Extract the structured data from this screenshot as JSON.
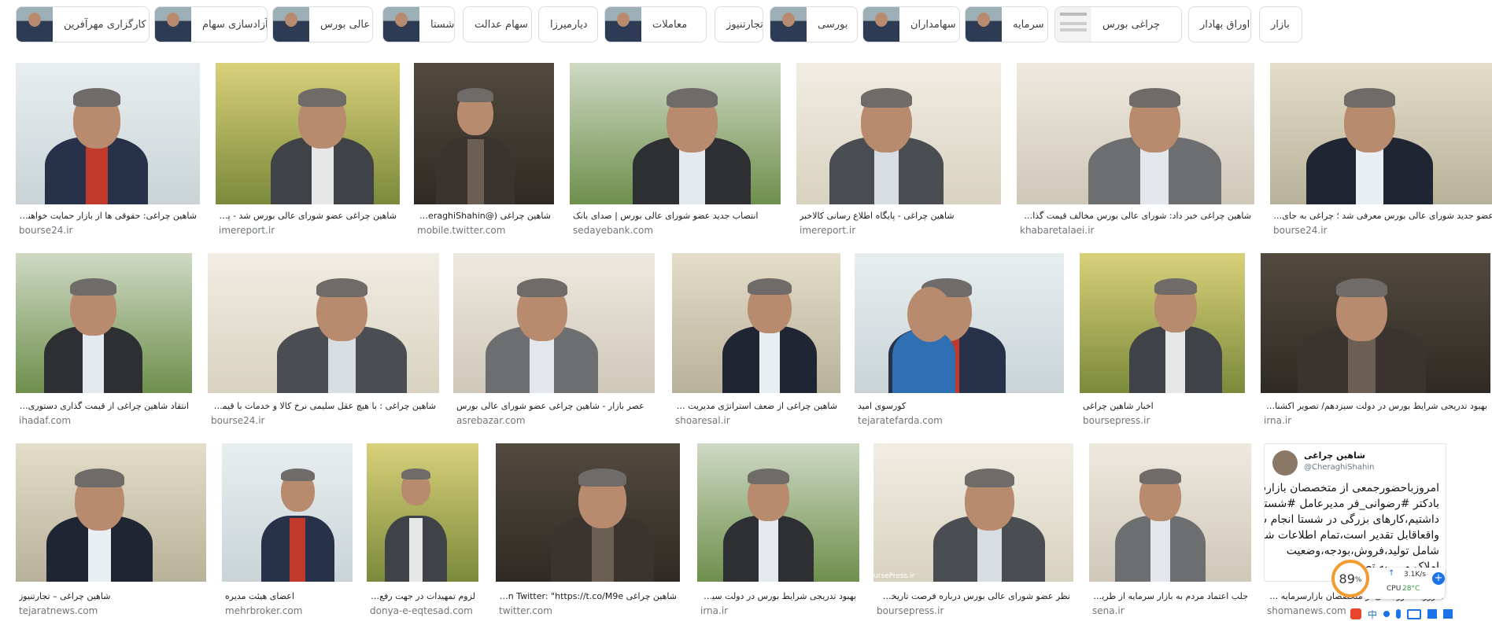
{
  "chips": [
    {
      "label": "بازار",
      "thumb": false
    },
    {
      "label": "اوراق بهادار",
      "thumb": false
    },
    {
      "label": "چراغی بورس",
      "thumb": "doc"
    },
    {
      "label": "سرمایه",
      "thumb": "face"
    },
    {
      "label": "سهامداران",
      "thumb": "face"
    },
    {
      "label": "بورسی",
      "thumb": "face"
    },
    {
      "label": "تجارتنیوز",
      "thumb": false
    },
    {
      "label": "معاملات",
      "thumb": "face"
    },
    {
      "label": "دیارمیرزا",
      "thumb": false
    },
    {
      "label": "سهام عدالت",
      "thumb": false
    },
    {
      "label": "شستا",
      "thumb": "face"
    },
    {
      "label": "عالی بورس",
      "thumb": "face"
    },
    {
      "label": "آزادسازی سهام",
      "thumb": "face"
    },
    {
      "label": "کارگزاری مهرآفرین",
      "thumb": "face"
    }
  ],
  "rows": [
    [
      {
        "caption": "شاهین چراغی: حقوقی ها از بازار حمایت خواهند کرد...",
        "source": "bourse24.ir"
      },
      {
        "caption": "شاهین چراغی عضو شورای عالی بورس شد - پایگاه ا...",
        "source": "imereport.ir"
      },
      {
        "caption": "شاهین چراغی (@CheraghiShahin)",
        "source": "mobile.twitter.com"
      },
      {
        "caption": "انتصاب جدید عضو شورای عالی بورس | صدای بانک",
        "source": "sedayebank.com"
      },
      {
        "caption": "شاهین چراغی - پایگاه اطلاع رسانی کالاخبر",
        "source": "imereport.ir"
      },
      {
        "caption": "شاهین چراغی خبر داد: شورای عالی بورس مخالف قیمت گذاری فولاد ...",
        "source": "khabaretalaei.ir"
      },
      {
        "caption": "عضو جدید شورای عالی بورس معرفی شد ؛ چراغی به جای عبده | ب...",
        "source": "bourse24.ir"
      }
    ],
    [
      {
        "caption": "انتقاد شاهین چراغی از قیمت گذاری دستوری محصـ...",
        "source": "ihadaf.com"
      },
      {
        "caption": "شاهین چراغی : با هیچ عقل سلیمی نرخ کالا و خدمات با قیمت سهام ...",
        "source": "bourse24.ir"
      },
      {
        "caption": "عصر بازار - شاهین چراغی عضو شورای عالی بورس",
        "source": "asrebazar.com"
      },
      {
        "caption": "شاهین چراغی از ضعف استراتژی مدیریت بورس ...",
        "source": "shoaresal.ir"
      },
      {
        "caption": "کورسوی امید",
        "source": "tejaratefarda.com"
      },
      {
        "caption": "اخبار شاهین چراغی",
        "source": "boursepress.ir"
      },
      {
        "caption": "بهبود تدریجی شرایط بورس در دولت سیزدهم/ تصویر اکشنافی ک...",
        "source": "irna.ir"
      }
    ],
    [
      {
        "caption": "شاهین چراغی – تجارتنیوز",
        "source": "tejaratnews.com"
      },
      {
        "caption": "اعضای هیئت مدیره",
        "source": "mehrbroker.com"
      },
      {
        "caption": "لزوم تمهیدات در جهت رفع چالـ...",
        "source": "donya-e-eqtesad.com"
      },
      {
        "caption": "شاهین چراغی on Twitter: \"https://t.co/M9e...",
        "source": "twitter.com"
      },
      {
        "caption": "بهبود تدریجی شرایط بورس در دولت سیزدهم/...",
        "source": "irna.ir"
      },
      {
        "caption": "نظر عضو شورای عالی بورس درباره فرصت تاریخی ، د...",
        "source": "boursepress.ir"
      },
      {
        "caption": "جلب اعتماد مردم به بازار سرمایه از طریق عـ...",
        "source": "sena.ir"
      },
      {
        "caption": "امروز‌باحضور‌جمعی از متخصصان بازارسرمایه شستا",
        "source": "shomanews.com"
      }
    ]
  ],
  "tweet": {
    "name": "شاهین چراغی",
    "handle": "@CheraghiShahin",
    "lines": [
      "امروزباحضورجمعی از متخصصان بازارسرمایه",
      "بادکتر #رضوانی_فر مدیرعامل #شستا نشستی",
      "داشتیم،کارهای بزرگی در شستا انجام شده که",
      "واقعاقابل تقدیر است،تمام اطلاعات شرکتها",
      "شامل تولید،فروش،بودجه،وضعیت",
      "املاک و ... به تصور"
    ]
  },
  "watermark": "ursePress.ir",
  "widget": {
    "percent": "89",
    "unit": "%",
    "speed": "3.1K/s",
    "cpu_label": "CPU",
    "cpu_temp": "28°C"
  }
}
